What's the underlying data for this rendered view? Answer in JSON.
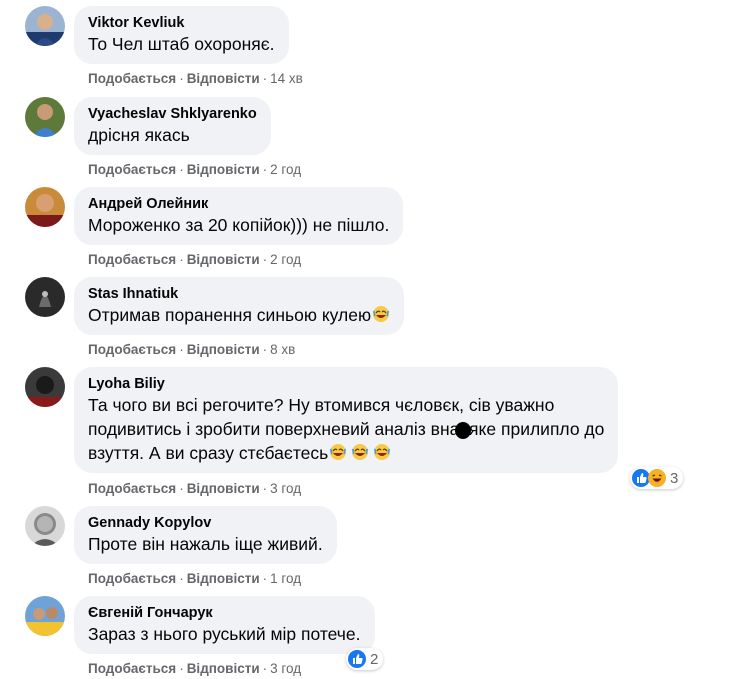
{
  "action_labels": {
    "like": "Подобається",
    "reply": "Відповісти"
  },
  "comments": [
    {
      "author": "Viktor Kevliuk",
      "text": "То Чел штаб охороняє.",
      "time": "14 хв"
    },
    {
      "author": "Vyacheslav Shklyarenko",
      "text": "дрісня якась",
      "time": "2 год"
    },
    {
      "author": "Андрей Олейник",
      "text": "Мороженко за 20 копійок))) не пішло.",
      "time": "2 год"
    },
    {
      "author": "Stas Ihnatiuk",
      "text": "Отримав поранення синьою кулею",
      "text_emoji": "rofl",
      "time": "8 хв"
    },
    {
      "author": "Lyoha Biliy",
      "lines": [
        "Та чого ви всі регочите? Ну втомився чєловєк, сів уважно",
        "подивитись і зробити поверхневий аналіз  вна, яке прилипло до",
        "взуття. А ви сразу стєбаєтесь"
      ],
      "text_emoji": "rofl-x3",
      "time": "3 год",
      "reactions": {
        "icons": [
          "like",
          "laugh"
        ],
        "count": "3"
      }
    },
    {
      "author": "Gennady Kopylov",
      "text": "Проте він нажаль іще живий.",
      "time": "1 год"
    },
    {
      "author": "Євгеній Гончарук",
      "text": "Зараз з нього руський мір потече.",
      "time": "3 год",
      "reactions": {
        "icons": [
          "like"
        ],
        "count": "2"
      }
    }
  ],
  "colors": {
    "bubble": "#f0f2f5",
    "meta_text": "#65676b",
    "like_blue": "#1877f2",
    "laugh_yellow": "#f7b125"
  }
}
